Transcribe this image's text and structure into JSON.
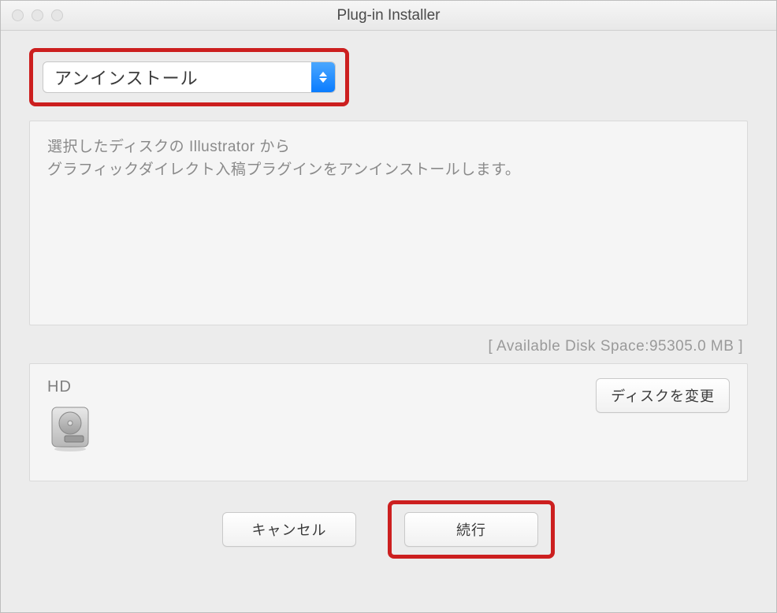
{
  "window": {
    "title": "Plug-in Installer"
  },
  "action_select": {
    "value": "アンインストール"
  },
  "description": {
    "line1": "選択したディスクの Illustrator から",
    "line2": "グラフィックダイレクト入稿プラグインをアンインストールします。"
  },
  "disk_space": {
    "label": "[ Available Disk Space:95305.0 MB ]"
  },
  "disk": {
    "name": "HD",
    "change_label": "ディスクを変更"
  },
  "buttons": {
    "cancel": "キャンセル",
    "continue": "続行"
  }
}
